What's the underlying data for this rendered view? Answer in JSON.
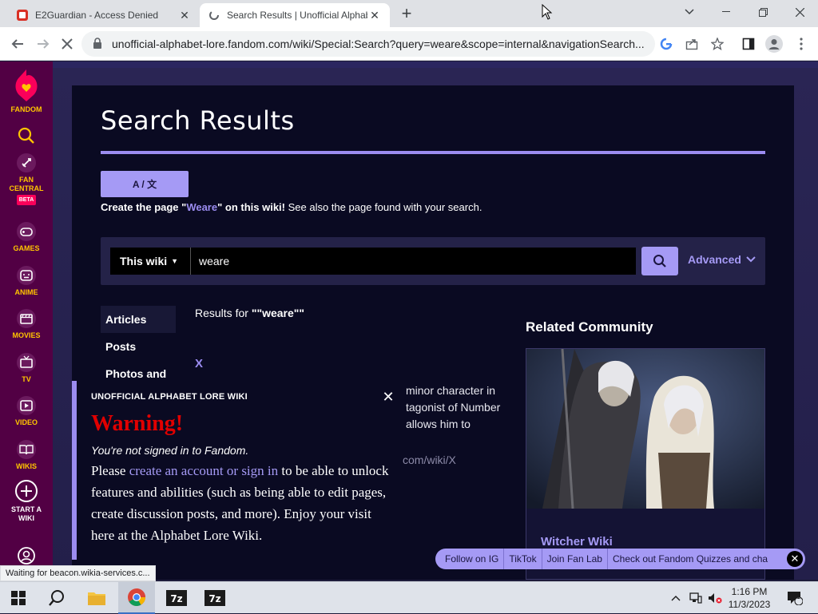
{
  "browser": {
    "tabs": [
      {
        "title": "E2Guardian - Access Denied",
        "active": false
      },
      {
        "title": "Search Results | Unofficial Alphab",
        "active": true
      }
    ],
    "url": "unofficial-alphabet-lore.fandom.com/wiki/Special:Search?query=weare&scope=internal&navigationSearch...",
    "status_tooltip": "Waiting for beacon.wikia-services.c..."
  },
  "rail": {
    "logo_label": "FANDOM",
    "items": [
      {
        "label": "FAN CENTRAL",
        "badge": "BETA"
      },
      {
        "label": "GAMES"
      },
      {
        "label": "ANIME"
      },
      {
        "label": "MOVIES"
      },
      {
        "label": "TV"
      },
      {
        "label": "VIDEO"
      },
      {
        "label": "WIKIS"
      },
      {
        "label": "START A WIKI"
      }
    ]
  },
  "main": {
    "title": "Search Results",
    "lang_button": "A / 文",
    "create_prefix": "Create the page \"",
    "create_term": "Weare",
    "create_suffix": "\" on this wiki!",
    "create_extra": " See also the page found with your search.",
    "scope_label": "This wiki",
    "search_value": "weare",
    "advanced_label": "Advanced",
    "side_tabs": [
      "Articles",
      "Posts",
      "Photos and"
    ],
    "results_for_prefix": "Results for ",
    "results_for_term": "\"\"weare\"\"",
    "result_title": "X",
    "snippet_lines": [
      "minor character in",
      "tagonist of Number",
      "allows him to"
    ],
    "snippet_url": "com/wiki/X"
  },
  "related": {
    "heading": "Related Community",
    "name": "Witcher Wiki"
  },
  "warning": {
    "wiki_name": "UNOFFICIAL ALPHABET LORE WIKI",
    "title": "Warning!",
    "subtitle": "You're not signed in to Fandom.",
    "body_pre": "Please ",
    "body_link": "create an account or sign in",
    "body_post": " to be able to unlock features and abilities (such as being able to edit pages, create discussion posts, and more). Enjoy your visit here at the Alphabet Lore Wiki."
  },
  "pillbar": [
    "Follow on IG",
    "TikTok",
    "Join Fan Lab",
    "Check out Fandom Quizzes and cha"
  ],
  "taskbar": {
    "time": "1:16 PM",
    "date": "11/3/2023",
    "notification_count": "1"
  },
  "colors": {
    "accent": "#a59af5",
    "rail": "#520044",
    "warning_red": "#e10000"
  }
}
